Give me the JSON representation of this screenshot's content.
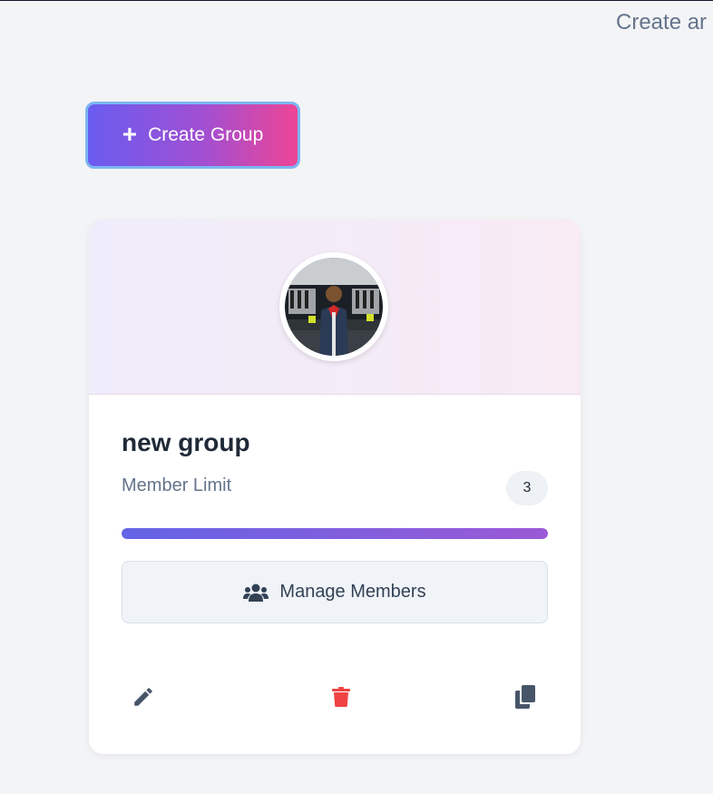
{
  "header": {
    "subtitle": "Create ar"
  },
  "create_button": {
    "label": "Create Group",
    "icon": "plus-icon"
  },
  "group_card": {
    "name": "new group",
    "member_limit_label": "Member Limit",
    "member_limit_value": "3",
    "progress_fraction": 1.0,
    "manage_members_label": "Manage Members",
    "actions": {
      "edit_icon": "pencil-icon",
      "delete_icon": "trash-icon",
      "copy_icon": "copy-icon"
    },
    "colors": {
      "delete": "#ef4444",
      "icons": "#475569",
      "accent_start": "#6366f1",
      "accent_end": "#ec4899"
    }
  }
}
